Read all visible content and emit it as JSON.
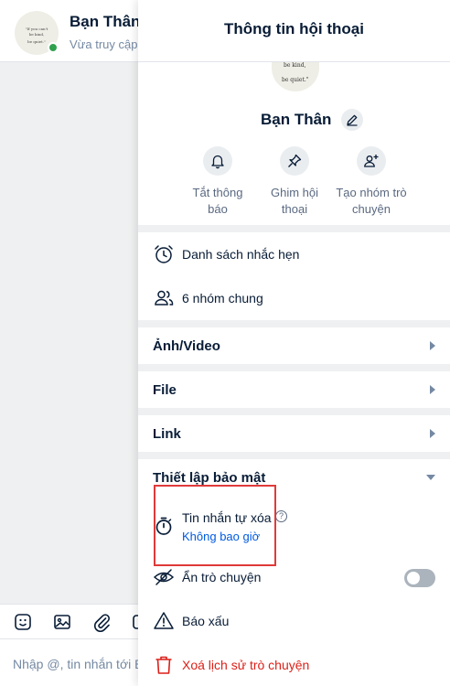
{
  "chat": {
    "name": "Bạn Thân",
    "status": "Vừa truy cập",
    "input_placeholder": "Nhập @, tin nhắn tới Bạn Thân",
    "avatar_quote": [
      "\"If you can't",
      "be kind,",
      "be quiet.\""
    ],
    "toolbar_icons": [
      "sticker-icon",
      "image-icon",
      "attachment-icon",
      "screenshot-icon"
    ]
  },
  "panel": {
    "title": "Thông tin hội thoại",
    "profile_name": "Bạn Thân",
    "avatar_quote": [
      "be kind,",
      "be quiet.\""
    ],
    "actions": [
      {
        "icon": "bell-icon",
        "label": "Tắt thông báo"
      },
      {
        "icon": "pin-icon",
        "label": "Ghim hội thoại"
      },
      {
        "icon": "add-group-icon",
        "label": "Tạo nhóm trò chuyện"
      }
    ],
    "reminders": "Danh sách nhắc hẹn",
    "common_groups": "6 nhóm chung",
    "sections": {
      "media": "Ảnh/Video",
      "file": "File",
      "link": "Link",
      "security": "Thiết lập bảo mật"
    },
    "self_destruct": {
      "label": "Tin nhắn tự xóa",
      "value": "Không bao giờ"
    },
    "hide_chat": {
      "label": "Ẩn trò chuyện",
      "enabled": false
    },
    "report": "Báo xấu",
    "delete_history": "Xoá lịch sử trò chuyện"
  },
  "colors": {
    "accent": "#005ae0",
    "danger": "#dc1f18",
    "highlight_box": "#e03a3a",
    "online": "#30a14e"
  }
}
